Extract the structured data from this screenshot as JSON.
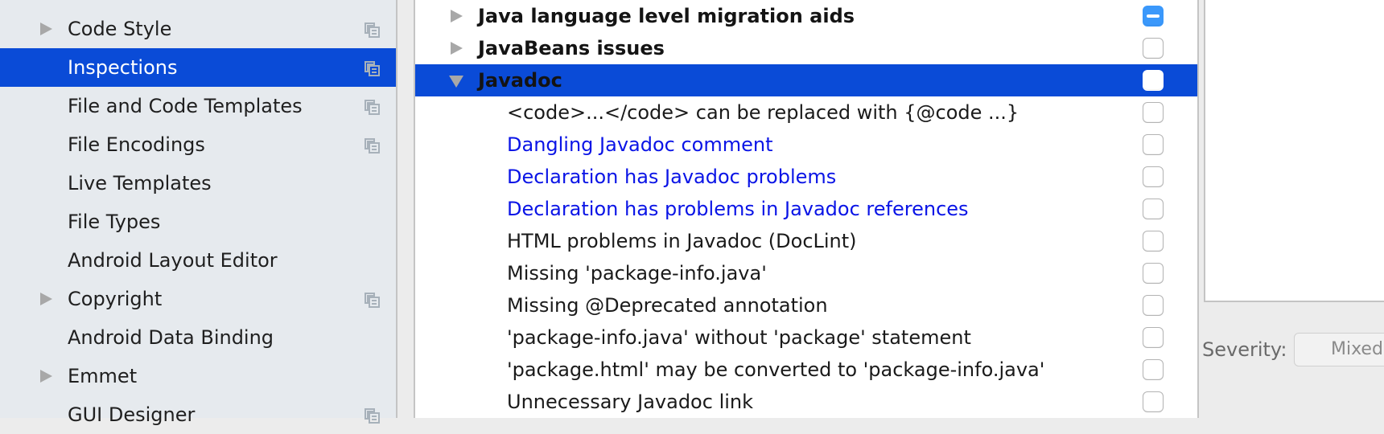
{
  "sidebar": {
    "items": [
      {
        "label": "Code Style",
        "expandable": true,
        "project_icon": true,
        "selected": false
      },
      {
        "label": "Inspections",
        "expandable": false,
        "project_icon": true,
        "selected": true
      },
      {
        "label": "File and Code Templates",
        "expandable": false,
        "project_icon": true,
        "selected": false
      },
      {
        "label": "File Encodings",
        "expandable": false,
        "project_icon": true,
        "selected": false
      },
      {
        "label": "Live Templates",
        "expandable": false,
        "project_icon": false,
        "selected": false
      },
      {
        "label": "File Types",
        "expandable": false,
        "project_icon": false,
        "selected": false
      },
      {
        "label": "Android Layout Editor",
        "expandable": false,
        "project_icon": false,
        "selected": false
      },
      {
        "label": "Copyright",
        "expandable": true,
        "project_icon": true,
        "selected": false
      },
      {
        "label": "Android Data Binding",
        "expandable": false,
        "project_icon": false,
        "selected": false
      },
      {
        "label": "Emmet",
        "expandable": true,
        "project_icon": false,
        "selected": false
      },
      {
        "label": "GUI Designer",
        "expandable": false,
        "project_icon": true,
        "selected": false
      }
    ]
  },
  "inspections": {
    "rows": [
      {
        "type": "group",
        "label": "Java language level migration aids",
        "expanded": false,
        "checkbox": "mixed",
        "selected": false
      },
      {
        "type": "group",
        "label": "JavaBeans issues",
        "expanded": false,
        "checkbox": "unchecked",
        "selected": false
      },
      {
        "type": "group",
        "label": "Javadoc",
        "expanded": true,
        "checkbox": "unchecked",
        "selected": true
      },
      {
        "type": "child",
        "label": "<code>...</code> can be replaced with {@code ...}",
        "link": false,
        "checkbox": "unchecked"
      },
      {
        "type": "child",
        "label": "Dangling Javadoc comment",
        "link": true,
        "checkbox": "unchecked"
      },
      {
        "type": "child",
        "label": "Declaration has Javadoc problems",
        "link": true,
        "checkbox": "unchecked"
      },
      {
        "type": "child",
        "label": "Declaration has problems in Javadoc references",
        "link": true,
        "checkbox": "unchecked"
      },
      {
        "type": "child",
        "label": "HTML problems in Javadoc (DocLint)",
        "link": false,
        "checkbox": "unchecked"
      },
      {
        "type": "child",
        "label": "Missing 'package-info.java'",
        "link": false,
        "checkbox": "unchecked"
      },
      {
        "type": "child",
        "label": "Missing @Deprecated annotation",
        "link": false,
        "checkbox": "unchecked"
      },
      {
        "type": "child",
        "label": "'package-info.java' without 'package' statement",
        "link": false,
        "checkbox": "unchecked"
      },
      {
        "type": "child",
        "label": "'package.html' may be converted to 'package-info.java'",
        "link": false,
        "checkbox": "unchecked"
      },
      {
        "type": "child",
        "label": "Unnecessary Javadoc link",
        "link": false,
        "checkbox": "unchecked"
      }
    ]
  },
  "details": {
    "severity_label": "Severity:",
    "severity_value": "Mixed"
  },
  "colors": {
    "selection": "#0a4bd7",
    "link_text": "#0a14e6",
    "checkbox_mixed": "#3a98fb",
    "sidebar_bg": "#e6eaee"
  }
}
